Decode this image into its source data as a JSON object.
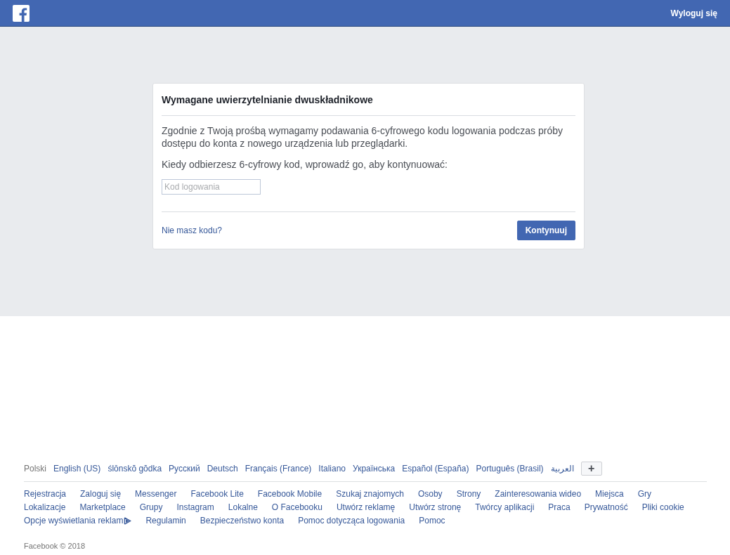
{
  "header": {
    "logout": "Wyloguj się"
  },
  "card": {
    "title": "Wymagane uwierzytelnianie dwuskładnikowe",
    "description": "Zgodnie z Twoją prośbą wymagamy podawania 6-cyfrowego kodu logowania podczas próby dostępu do konta z nowego urządzenia lub przeglądarki.",
    "prompt": "Kiedy odbierzesz 6-cyfrowy kod, wprowadź go, aby kontynuować:",
    "code_field": {
      "placeholder": "Kod logowania"
    },
    "no_code_link": "Nie masz kodu?",
    "continue_button": "Kontynuuj"
  },
  "footer": {
    "languages": [
      {
        "label": "Polski",
        "selected": true
      },
      {
        "label": "English (US)",
        "selected": false
      },
      {
        "label": "ślōnskŏ gŏdka",
        "selected": false
      },
      {
        "label": "Русский",
        "selected": false
      },
      {
        "label": "Deutsch",
        "selected": false
      },
      {
        "label": "Français (France)",
        "selected": false
      },
      {
        "label": "Italiano",
        "selected": false
      },
      {
        "label": "Українська",
        "selected": false
      },
      {
        "label": "Español (España)",
        "selected": false
      },
      {
        "label": "Português (Brasil)",
        "selected": false
      },
      {
        "label": "العربية",
        "selected": false
      }
    ],
    "more_languages_button": "+",
    "links": [
      {
        "label": "Rejestracja"
      },
      {
        "label": "Zaloguj się"
      },
      {
        "label": "Messenger"
      },
      {
        "label": "Facebook Lite"
      },
      {
        "label": "Facebook Mobile"
      },
      {
        "label": "Szukaj znajomych"
      },
      {
        "label": "Osoby"
      },
      {
        "label": "Strony"
      },
      {
        "label": "Zainteresowania wideo"
      },
      {
        "label": "Miejsca"
      },
      {
        "label": "Gry"
      },
      {
        "label": "Lokalizacje"
      },
      {
        "label": "Marketplace"
      },
      {
        "label": "Grupy"
      },
      {
        "label": "Instagram"
      },
      {
        "label": "Lokalne"
      },
      {
        "label": "O Facebooku"
      },
      {
        "label": "Utwórz reklamę"
      },
      {
        "label": "Utwórz stronę"
      },
      {
        "label": "Twórcy aplikacji"
      },
      {
        "label": "Praca"
      },
      {
        "label": "Prywatność"
      },
      {
        "label": "Pliki cookie"
      },
      {
        "label": "Opcje wyświetlania reklam",
        "kind": "adchoices"
      },
      {
        "label": "Regulamin"
      },
      {
        "label": "Bezpieczeństwo konta"
      },
      {
        "label": "Pomoc dotycząca logowania"
      },
      {
        "label": "Pomoc"
      }
    ],
    "copyright": "Facebook © 2018"
  }
}
